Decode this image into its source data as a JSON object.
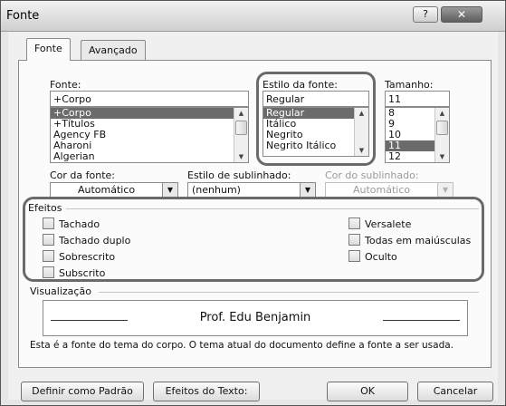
{
  "window": {
    "title": "Fonte",
    "help": "?",
    "close": "✕"
  },
  "tabs": [
    {
      "label": "Fonte"
    },
    {
      "label": "Avançado"
    }
  ],
  "font": {
    "label": "Fonte:",
    "value": "+Corpo",
    "items": [
      "+Corpo",
      "+Títulos",
      "Agency FB",
      "Aharoni",
      "Algerian"
    ],
    "selected": "+Corpo"
  },
  "style": {
    "label": "Estilo da fonte:",
    "value": "Regular",
    "items": [
      "Regular",
      "Itálico",
      "Negrito",
      "Negrito Itálico"
    ],
    "selected": "Regular"
  },
  "size": {
    "label": "Tamanho:",
    "value": "11",
    "items": [
      "8",
      "9",
      "10",
      "11",
      "12"
    ],
    "selected": "11"
  },
  "color": {
    "label": "Cor da fonte:",
    "value": "Automático"
  },
  "underline_style": {
    "label": "Estilo de sublinhado:",
    "value": "(nenhum)"
  },
  "underline_color": {
    "label": "Cor do sublinhado:",
    "value": "Automático"
  },
  "effects": {
    "label": "Efeitos",
    "left": [
      "Tachado",
      "Tachado duplo",
      "Sobrescrito",
      "Subscrito"
    ],
    "right": [
      "Versalete",
      "Todas em maiúsculas",
      "Oculto"
    ]
  },
  "preview": {
    "label": "Visualização",
    "sample": "Prof. Edu Benjamin",
    "description": "Esta é a fonte do tema do corpo. O tema atual do documento define a fonte a ser usada."
  },
  "buttons": {
    "default": "Definir como Padrão",
    "text_effects": "Efeitos do Texto:",
    "ok": "OK",
    "cancel": "Cancelar"
  },
  "icons": {
    "help": "help-icon",
    "close": "close-icon",
    "dropdown": "chevron-down-icon",
    "scroll_up": "arrow-up-icon",
    "scroll_down": "arrow-down-icon"
  },
  "colors": {
    "selection": "#6b6b6b",
    "ring": "#6a6a6a",
    "titlebar": "#dcdcdc"
  }
}
